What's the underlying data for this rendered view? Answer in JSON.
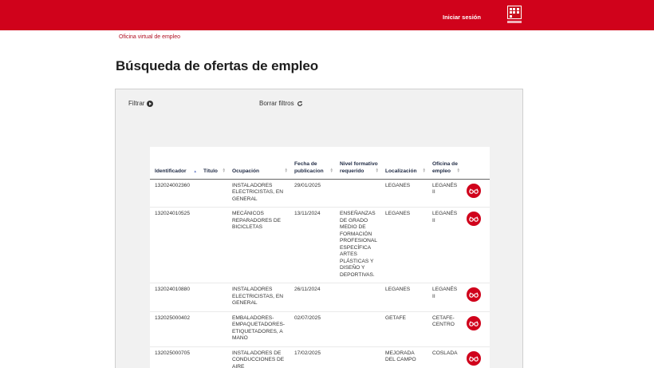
{
  "header": {
    "login_label": "Iniciar sesión",
    "logo_icon": "comunidad-madrid-logo",
    "brand_color": "#d0021b"
  },
  "breadcrumb": "Oficina virtual de empleo",
  "page_title": "Búsqueda de ofertas de empleo",
  "toolbar": {
    "filter_label": "Filtrar",
    "clear_label": "Borrar filtros"
  },
  "table": {
    "columns": [
      "Identificador",
      "Título",
      "Ocupación",
      "Fecha de publicacion",
      "Nivel formativo requerido",
      "Localización",
      "Oficina de empleo"
    ],
    "rows": [
      {
        "id": "132024002360",
        "titulo": "",
        "ocupacion": "Instaladores electricistas, en general",
        "fecha": "29/01/2025",
        "nivel": "",
        "localizacion": "Leganes",
        "oficina": "Leganés II"
      },
      {
        "id": "132024010525",
        "titulo": "",
        "ocupacion": "Mecánicos reparadores de bicicletas",
        "fecha": "13/11/2024",
        "nivel": "Enseñanzas de grado medio de formación profesional específica artes plásticas y diseño y deportivas.",
        "localizacion": "Leganes",
        "oficina": "Leganés II"
      },
      {
        "id": "132024010880",
        "titulo": "",
        "ocupacion": "Instaladores electricistas, en general",
        "fecha": "26/11/2024",
        "nivel": "",
        "localizacion": "Leganes",
        "oficina": "Leganés II"
      },
      {
        "id": "132025000402",
        "titulo": "",
        "ocupacion": "Embaladores-empaquetadores-etiquetadores, a mano",
        "fecha": "02/07/2025",
        "nivel": "",
        "localizacion": "Getafe",
        "oficina": "Cetafe-Centro"
      },
      {
        "id": "132025000705",
        "titulo": "",
        "ocupacion": "Instaladores de conducciones de aire acondicionado y",
        "fecha": "17/02/2025",
        "nivel": "",
        "localizacion": "Mejorada del Campo",
        "oficina": "Coslada"
      }
    ],
    "row_action_icon": "view-glasses-icon"
  }
}
